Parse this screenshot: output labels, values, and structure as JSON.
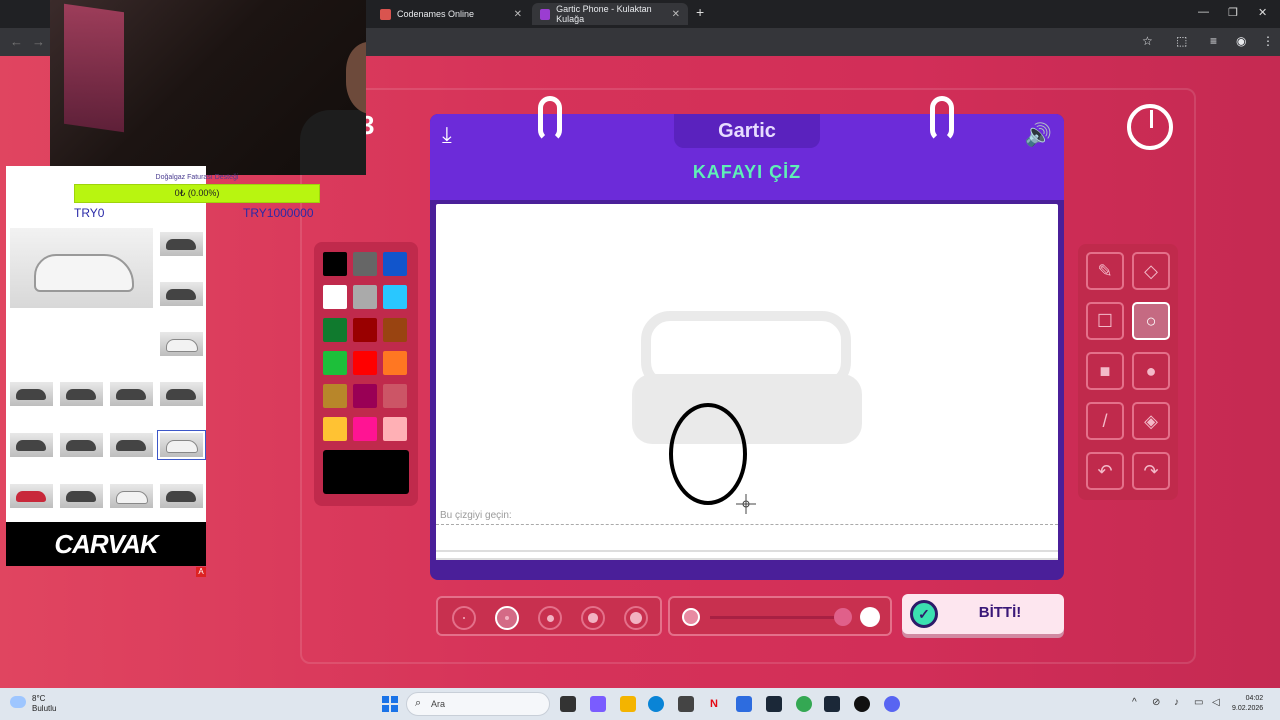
{
  "browser": {
    "tabs": [
      {
        "title": "Codenames Online",
        "color": "#d9544f"
      },
      {
        "title": "Gartic Phone - Kulaktan Kulağa",
        "color": "#9b3dd1"
      }
    ],
    "new_tab": "+",
    "close": "✕",
    "minimize": "—",
    "maximize": "❐",
    "window_close": "✕"
  },
  "game": {
    "logo": "Gartic",
    "title": "KAFAYI ÇİZ",
    "round_number": "3",
    "hint": "Bu çizgiyi geçin:",
    "done_label": "BİTTİ!",
    "download_icon": "download-icon",
    "volume_icon": "volume-icon",
    "palette": [
      "#000000",
      "#666666",
      "#1155cc",
      "#ffffff",
      "#aaaaaa",
      "#29c7ff",
      "#107a2e",
      "#990000",
      "#994411",
      "#1dbf3a",
      "#ff0000",
      "#ff7722",
      "#b8862a",
      "#990055",
      "#cc5566",
      "#ffc233",
      "#ff1493",
      "#ffb0b5"
    ],
    "selected_color": "#000000",
    "tools": [
      {
        "name": "pencil-icon",
        "glyph": "✎"
      },
      {
        "name": "eraser-icon",
        "glyph": "◇"
      },
      {
        "name": "rectangle-outline-icon",
        "glyph": "☐"
      },
      {
        "name": "ellipse-outline-icon",
        "glyph": "○"
      },
      {
        "name": "rectangle-fill-icon",
        "glyph": "■"
      },
      {
        "name": "ellipse-fill-icon",
        "glyph": "●"
      },
      {
        "name": "line-icon",
        "glyph": "/"
      },
      {
        "name": "fill-bucket-icon",
        "glyph": "◈"
      },
      {
        "name": "undo-icon",
        "glyph": "↶"
      },
      {
        "name": "redo-icon",
        "glyph": "↷"
      }
    ],
    "selected_tool": "ellipse-outline-icon",
    "brush_sizes": 5,
    "selected_brush_size": 2,
    "opacity": 1.0
  },
  "overlay": {
    "goal_label": "Doğalgaz Faturası Desteği",
    "goal_progress": "0₺ (0.00%)",
    "goal_fraction": 0.0,
    "try_min": "TRY0",
    "try_max": "TRY1000000",
    "brand": "CARVAK",
    "badge": "A"
  },
  "taskbar": {
    "temp": "8°C",
    "weather": "Bulutlu",
    "search": "Ara",
    "time": "04:02",
    "date": "9.02.2026"
  }
}
